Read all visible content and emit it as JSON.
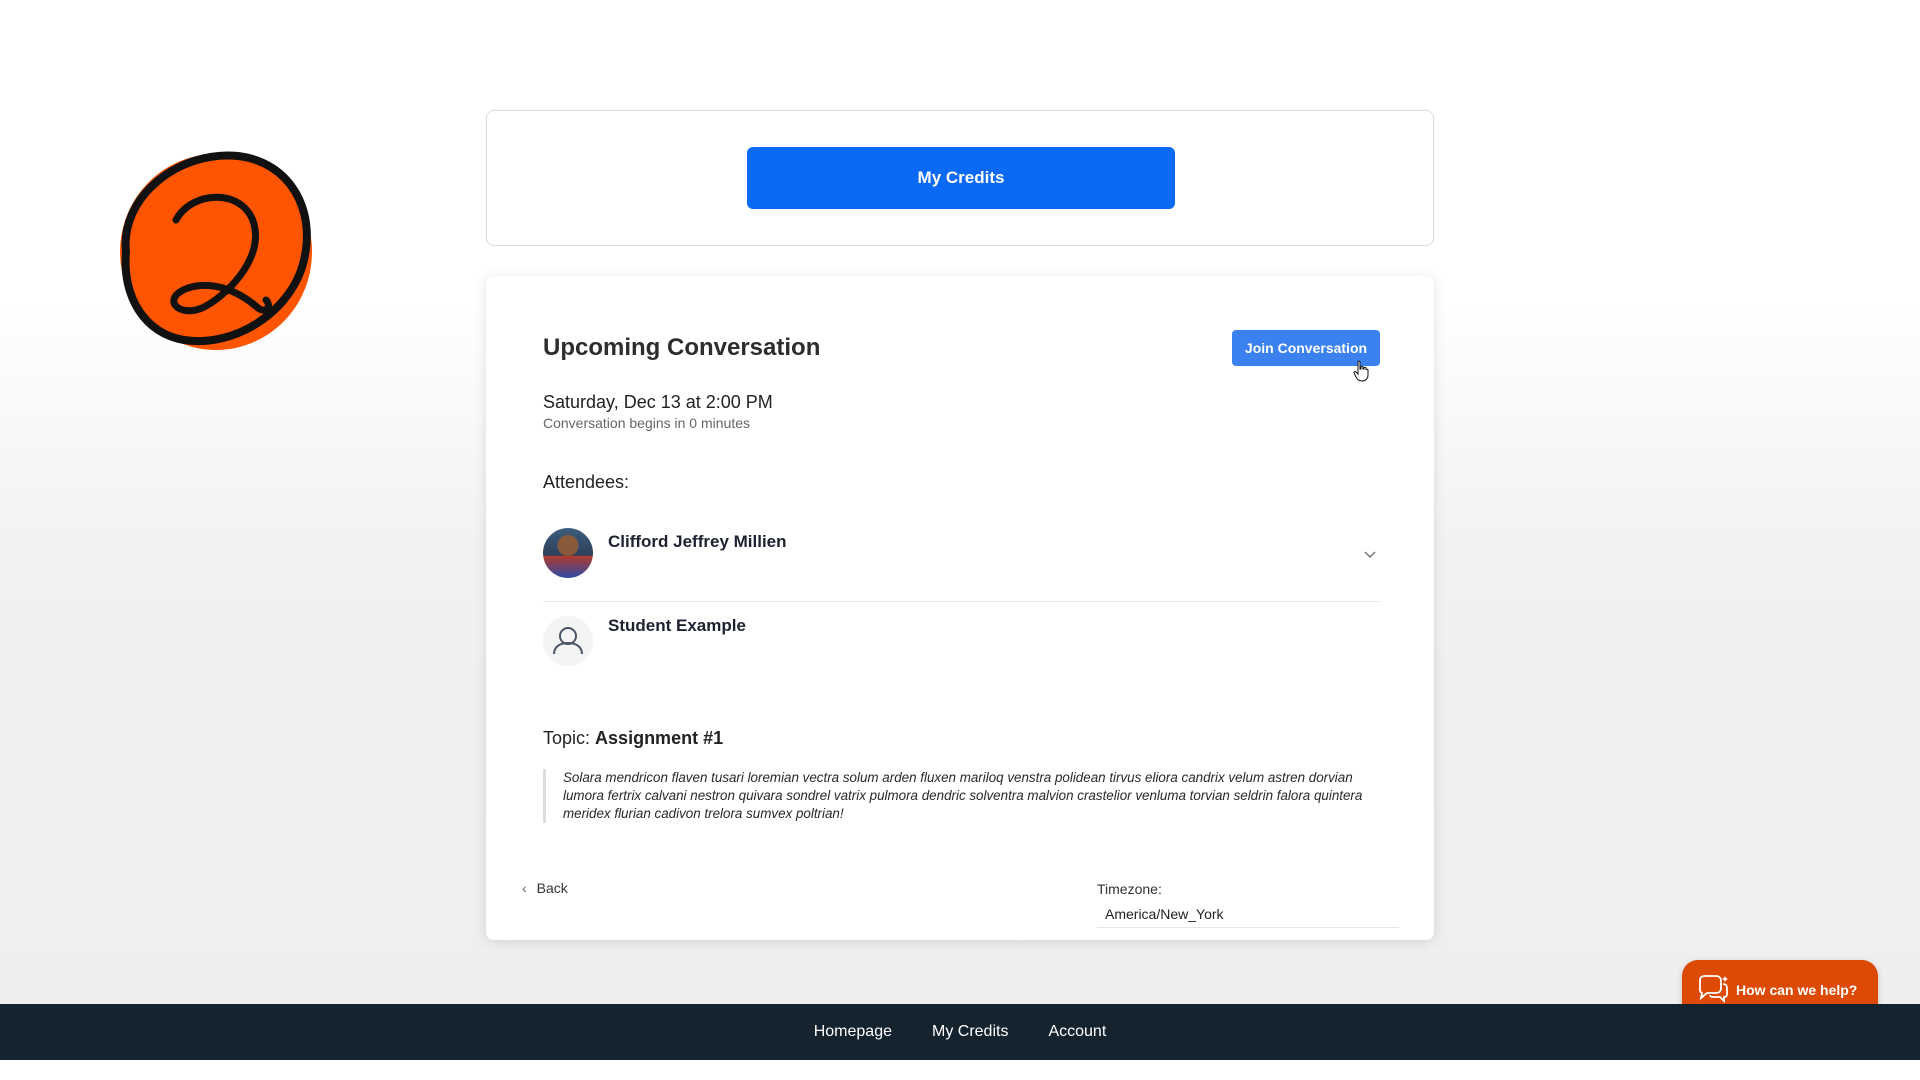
{
  "logo": {
    "icon": "q-logo-icon",
    "color": "#ff5500"
  },
  "credits_card": {
    "button_label": "My Credits"
  },
  "conversation": {
    "title": "Upcoming Conversation",
    "join_label": "Join Conversation",
    "date": "Saturday, Dec 13 at 2:00 PM",
    "begins": "Conversation begins in 0 minutes",
    "attendees_label": "Attendees:",
    "attendees": [
      {
        "name": "Clifford Jeffrey Millien",
        "avatar": "photo"
      },
      {
        "name": "Student Example",
        "avatar": "person-icon"
      }
    ],
    "topic_label": "Topic:",
    "topic_name": "Assignment #1",
    "description": "Solara mendricon flaven tusari loremian vectra solum arden fluxen mariloq venstra polidean tirvus eliora candrix velum astren dorvian lumora fertrix calvani nestron quivara sondrel vatrix pulmora dendric solventra malvion crastelior venluma torvian seldrin falora quintera meridex flurian cadivon trelora sumvex poltrian!",
    "back_label": "Back",
    "timezone_label": "Timezone:",
    "timezone_value": "America/New_York"
  },
  "help": {
    "label": "How can we help?"
  },
  "footer": {
    "links": [
      "Homepage",
      "My Credits",
      "Account"
    ]
  },
  "colors": {
    "primary": "#0a6af5",
    "join": "#3b82f0",
    "help": "#dd4a06",
    "footer": "#15232f"
  }
}
